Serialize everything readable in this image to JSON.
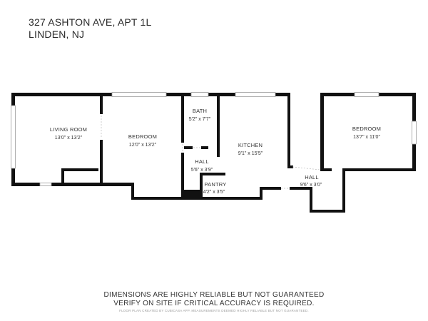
{
  "header": {
    "address_line1": "327 ASHTON AVE, APT 1L",
    "address_line2": "LINDEN, NJ"
  },
  "rooms": [
    {
      "name": "LIVING ROOM",
      "dims": "13'0\" x 13'2\""
    },
    {
      "name": "BEDROOM",
      "dims": "12'0\" x 13'2\""
    },
    {
      "name": "BATH",
      "dims": "5'2\" x 7'7\""
    },
    {
      "name": "HALL",
      "dims": "5'6\" x 3'9\""
    },
    {
      "name": "PANTRY",
      "dims": "4'2\" x 3'5\""
    },
    {
      "name": "KITCHEN",
      "dims": "9'1\" x 15'5\""
    },
    {
      "name": "HALL",
      "dims": "9'6\" x 3'0\""
    },
    {
      "name": "BEDROOM",
      "dims": "13'7\" x 11'0\""
    }
  ],
  "disclaimer": {
    "line1": "DIMENSIONS ARE HIGHLY RELIABLE BUT NOT GUARANTEED",
    "line2": "VERIFY ON SITE IF CRITICAL ACCURACY IS REQUIRED.",
    "line3": "FLOOR PLAN CREATED BY CUBICASA APP. MEASUREMENTS DEEMED HIGHLY RELIABLE BUT NOT GUARANTEED."
  },
  "colors": {
    "wall": "#111111",
    "window": "#9a9a9a"
  }
}
